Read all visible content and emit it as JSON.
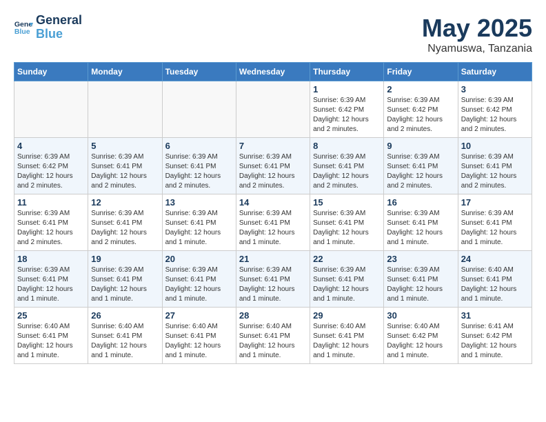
{
  "header": {
    "logo_line1": "General",
    "logo_line2": "Blue",
    "title": "May 2025",
    "subtitle": "Nyamuswa, Tanzania"
  },
  "weekdays": [
    "Sunday",
    "Monday",
    "Tuesday",
    "Wednesday",
    "Thursday",
    "Friday",
    "Saturday"
  ],
  "weeks": [
    [
      {
        "day": "",
        "info": ""
      },
      {
        "day": "",
        "info": ""
      },
      {
        "day": "",
        "info": ""
      },
      {
        "day": "",
        "info": ""
      },
      {
        "day": "1",
        "info": "Sunrise: 6:39 AM\nSunset: 6:42 PM\nDaylight: 12 hours\nand 2 minutes."
      },
      {
        "day": "2",
        "info": "Sunrise: 6:39 AM\nSunset: 6:42 PM\nDaylight: 12 hours\nand 2 minutes."
      },
      {
        "day": "3",
        "info": "Sunrise: 6:39 AM\nSunset: 6:42 PM\nDaylight: 12 hours\nand 2 minutes."
      }
    ],
    [
      {
        "day": "4",
        "info": "Sunrise: 6:39 AM\nSunset: 6:42 PM\nDaylight: 12 hours\nand 2 minutes."
      },
      {
        "day": "5",
        "info": "Sunrise: 6:39 AM\nSunset: 6:41 PM\nDaylight: 12 hours\nand 2 minutes."
      },
      {
        "day": "6",
        "info": "Sunrise: 6:39 AM\nSunset: 6:41 PM\nDaylight: 12 hours\nand 2 minutes."
      },
      {
        "day": "7",
        "info": "Sunrise: 6:39 AM\nSunset: 6:41 PM\nDaylight: 12 hours\nand 2 minutes."
      },
      {
        "day": "8",
        "info": "Sunrise: 6:39 AM\nSunset: 6:41 PM\nDaylight: 12 hours\nand 2 minutes."
      },
      {
        "day": "9",
        "info": "Sunrise: 6:39 AM\nSunset: 6:41 PM\nDaylight: 12 hours\nand 2 minutes."
      },
      {
        "day": "10",
        "info": "Sunrise: 6:39 AM\nSunset: 6:41 PM\nDaylight: 12 hours\nand 2 minutes."
      }
    ],
    [
      {
        "day": "11",
        "info": "Sunrise: 6:39 AM\nSunset: 6:41 PM\nDaylight: 12 hours\nand 2 minutes."
      },
      {
        "day": "12",
        "info": "Sunrise: 6:39 AM\nSunset: 6:41 PM\nDaylight: 12 hours\nand 2 minutes."
      },
      {
        "day": "13",
        "info": "Sunrise: 6:39 AM\nSunset: 6:41 PM\nDaylight: 12 hours\nand 1 minute."
      },
      {
        "day": "14",
        "info": "Sunrise: 6:39 AM\nSunset: 6:41 PM\nDaylight: 12 hours\nand 1 minute."
      },
      {
        "day": "15",
        "info": "Sunrise: 6:39 AM\nSunset: 6:41 PM\nDaylight: 12 hours\nand 1 minute."
      },
      {
        "day": "16",
        "info": "Sunrise: 6:39 AM\nSunset: 6:41 PM\nDaylight: 12 hours\nand 1 minute."
      },
      {
        "day": "17",
        "info": "Sunrise: 6:39 AM\nSunset: 6:41 PM\nDaylight: 12 hours\nand 1 minute."
      }
    ],
    [
      {
        "day": "18",
        "info": "Sunrise: 6:39 AM\nSunset: 6:41 PM\nDaylight: 12 hours\nand 1 minute."
      },
      {
        "day": "19",
        "info": "Sunrise: 6:39 AM\nSunset: 6:41 PM\nDaylight: 12 hours\nand 1 minute."
      },
      {
        "day": "20",
        "info": "Sunrise: 6:39 AM\nSunset: 6:41 PM\nDaylight: 12 hours\nand 1 minute."
      },
      {
        "day": "21",
        "info": "Sunrise: 6:39 AM\nSunset: 6:41 PM\nDaylight: 12 hours\nand 1 minute."
      },
      {
        "day": "22",
        "info": "Sunrise: 6:39 AM\nSunset: 6:41 PM\nDaylight: 12 hours\nand 1 minute."
      },
      {
        "day": "23",
        "info": "Sunrise: 6:39 AM\nSunset: 6:41 PM\nDaylight: 12 hours\nand 1 minute."
      },
      {
        "day": "24",
        "info": "Sunrise: 6:40 AM\nSunset: 6:41 PM\nDaylight: 12 hours\nand 1 minute."
      }
    ],
    [
      {
        "day": "25",
        "info": "Sunrise: 6:40 AM\nSunset: 6:41 PM\nDaylight: 12 hours\nand 1 minute."
      },
      {
        "day": "26",
        "info": "Sunrise: 6:40 AM\nSunset: 6:41 PM\nDaylight: 12 hours\nand 1 minute."
      },
      {
        "day": "27",
        "info": "Sunrise: 6:40 AM\nSunset: 6:41 PM\nDaylight: 12 hours\nand 1 minute."
      },
      {
        "day": "28",
        "info": "Sunrise: 6:40 AM\nSunset: 6:41 PM\nDaylight: 12 hours\nand 1 minute."
      },
      {
        "day": "29",
        "info": "Sunrise: 6:40 AM\nSunset: 6:41 PM\nDaylight: 12 hours\nand 1 minute."
      },
      {
        "day": "30",
        "info": "Sunrise: 6:40 AM\nSunset: 6:42 PM\nDaylight: 12 hours\nand 1 minute."
      },
      {
        "day": "31",
        "info": "Sunrise: 6:41 AM\nSunset: 6:42 PM\nDaylight: 12 hours\nand 1 minute."
      }
    ]
  ]
}
